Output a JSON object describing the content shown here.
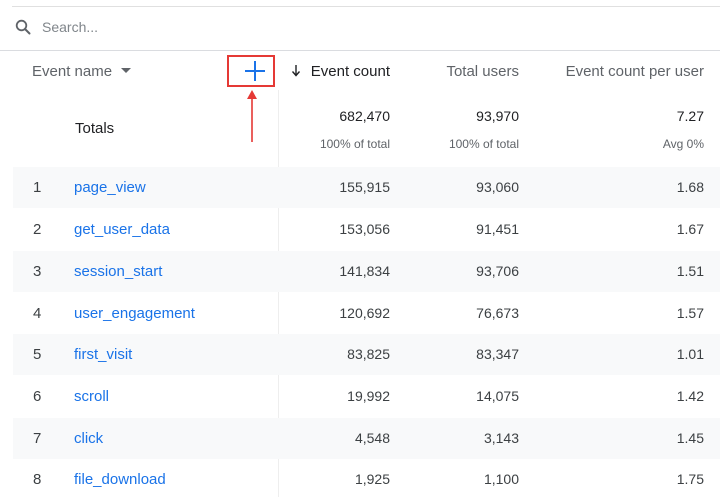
{
  "search": {
    "placeholder": "Search..."
  },
  "header": {
    "event_name": "Event name",
    "event_count": "Event count",
    "total_users": "Total users",
    "event_count_per_user": "Event count per user"
  },
  "totals": {
    "label": "Totals",
    "event_count": "682,470",
    "event_count_sub": "100% of total",
    "total_users": "93,970",
    "total_users_sub": "100% of total",
    "ecpu": "7.27",
    "ecpu_sub": "Avg 0%"
  },
  "rows": [
    {
      "num": "1",
      "name": "page_view",
      "event_count": "155,915",
      "total_users": "93,060",
      "ecpu": "1.68"
    },
    {
      "num": "2",
      "name": "get_user_data",
      "event_count": "153,056",
      "total_users": "91,451",
      "ecpu": "1.67"
    },
    {
      "num": "3",
      "name": "session_start",
      "event_count": "141,834",
      "total_users": "93,706",
      "ecpu": "1.51"
    },
    {
      "num": "4",
      "name": "user_engagement",
      "event_count": "120,692",
      "total_users": "76,673",
      "ecpu": "1.57"
    },
    {
      "num": "5",
      "name": "first_visit",
      "event_count": "83,825",
      "total_users": "83,347",
      "ecpu": "1.01"
    },
    {
      "num": "6",
      "name": "scroll",
      "event_count": "19,992",
      "total_users": "14,075",
      "ecpu": "1.42"
    },
    {
      "num": "7",
      "name": "click",
      "event_count": "4,548",
      "total_users": "3,143",
      "ecpu": "1.45"
    },
    {
      "num": "8",
      "name": "file_download",
      "event_count": "1,925",
      "total_users": "1,100",
      "ecpu": "1.75"
    }
  ],
  "colors": {
    "link": "#1a73e8",
    "highlight": "#e53935",
    "row_shade": "#f8f9fa"
  }
}
